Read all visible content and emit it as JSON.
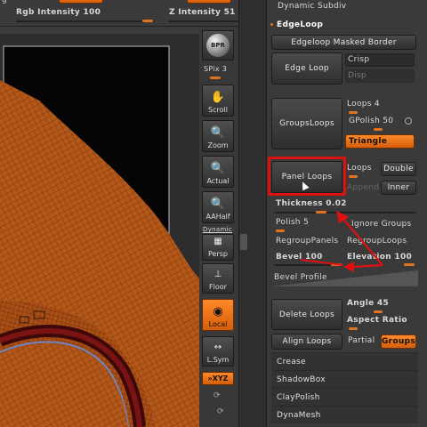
{
  "top": {
    "rgb_intensity": "Rgb Intensity 100",
    "z_intensity": "Z Intensity 51",
    "partial_left": "g"
  },
  "toolbar": {
    "bpr": "BPR",
    "spix": "SPix 3",
    "scroll": "Scroll",
    "zoom": "Zoom",
    "actual": "Actual",
    "aahalf": "AAHalf",
    "dynamic": "Dynamic",
    "persp": "Persp",
    "floor": "Floor",
    "local": "Local",
    "lsym": "L.Sym",
    "xyz": "»XYZ"
  },
  "panel": {
    "dynamic_subdiv": "Dynamic Subdiv",
    "edgeloop_header": "EdgeLoop",
    "edgeloop_masked_border": "Edgeloop Masked Border",
    "edge_loop": "Edge Loop",
    "crisp": "Crisp",
    "disp": "Disp",
    "groups_loops": "GroupsLoops",
    "loops_4": "Loops 4",
    "gpolish": "GPolish 50",
    "triangle": "Triangle",
    "panel_loops": "Panel Loops",
    "loops": "Loops",
    "double": "Double",
    "append": "Append",
    "inner": "Inner",
    "thickness": "Thickness 0.02",
    "polish": "Polish 5",
    "ignore_groups": "Ignore Groups",
    "regroup_panels": "RegroupPanels",
    "regroup_loops": "RegroupLoops",
    "bevel": "Bevel 100",
    "elevation": "Elevation 100",
    "bevel_profile": "Bevel Profile",
    "delete_loops": "Delete Loops",
    "angle": "Angle 45",
    "aspect_ratio": "Aspect Ratio",
    "align_loops": "Align Loops",
    "partial": "Partial",
    "groups": "Groups",
    "crease": "Crease",
    "shadowbox": "ShadowBox",
    "claypolish": "ClayPolish",
    "dynamesh": "DynaMesh"
  },
  "colors": {
    "accent": "#e2731c",
    "annotation": "#e01010",
    "mesh": "#b85a18"
  },
  "sliders": {
    "rgb_intensity": 1.0,
    "z_intensity": 0.51,
    "gpolish": 0.5,
    "thickness": 0.4,
    "polish": 0.05,
    "bevel": 0.8,
    "elevation": 1.0,
    "angle": 0.5
  }
}
